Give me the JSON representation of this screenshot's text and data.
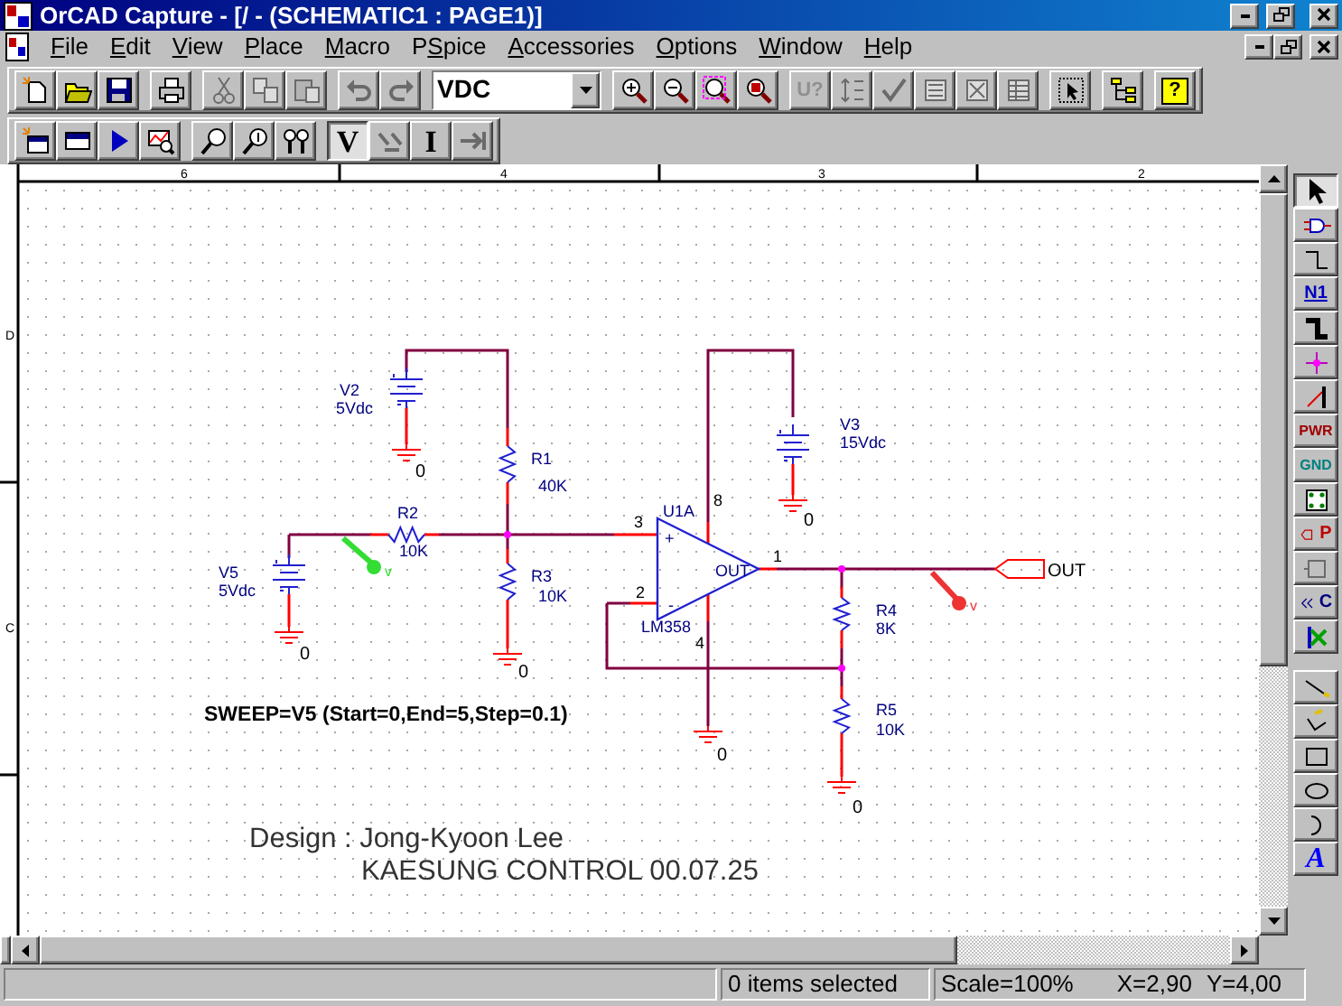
{
  "window": {
    "title": "OrCAD Capture - [/ - (SCHEMATIC1 : PAGE1)]"
  },
  "menu": [
    {
      "key": "F",
      "post": "ile"
    },
    {
      "key": "E",
      "post": "dit"
    },
    {
      "key": "V",
      "post": "iew"
    },
    {
      "key": "P",
      "post": "lace"
    },
    {
      "key": "M",
      "post": "acro"
    },
    {
      "pre": "P",
      "key": "S",
      "post": "pice"
    },
    {
      "key": "A",
      "post": "ccessories"
    },
    {
      "key": "O",
      "post": "ptions"
    },
    {
      "key": "W",
      "post": "indow"
    },
    {
      "key": "H",
      "post": "elp"
    }
  ],
  "toolbar_1": [
    [
      {
        "kind": "new",
        "disabled": false
      },
      {
        "kind": "open",
        "disabled": false
      },
      {
        "kind": "save",
        "disabled": false
      }
    ],
    [
      {
        "kind": "print",
        "disabled": false
      }
    ],
    [
      {
        "kind": "cut",
        "disabled": true
      },
      {
        "kind": "copy",
        "disabled": true
      },
      {
        "kind": "paste",
        "disabled": true
      }
    ],
    [
      {
        "kind": "undo",
        "disabled": true
      },
      {
        "kind": "redo",
        "disabled": true
      }
    ],
    [
      {
        "kind": "combo",
        "value": "VDC"
      }
    ],
    [
      {
        "kind": "zoom-in",
        "disabled": false
      },
      {
        "kind": "zoom-out",
        "disabled": false
      },
      {
        "kind": "zoom-area",
        "disabled": false
      },
      {
        "kind": "zoom-all",
        "disabled": false
      }
    ],
    [
      {
        "kind": "annotate",
        "label": "U?",
        "disabled": true
      },
      {
        "kind": "back-annotate",
        "disabled": true
      },
      {
        "kind": "drc",
        "disabled": true
      },
      {
        "kind": "netlist",
        "disabled": true
      },
      {
        "kind": "cross-ref",
        "disabled": true
      },
      {
        "kind": "bom",
        "disabled": true
      }
    ],
    [
      {
        "kind": "project",
        "disabled": false
      }
    ],
    [
      {
        "kind": "hierarchy",
        "disabled": false
      }
    ],
    [
      {
        "kind": "help",
        "label": "?",
        "disabled": false
      }
    ]
  ],
  "toolbar_2": [
    [
      {
        "kind": "new-profile",
        "disabled": false
      },
      {
        "kind": "edit-profile",
        "disabled": false
      },
      {
        "kind": "run",
        "disabled": false
      },
      {
        "kind": "view-results",
        "disabled": false
      }
    ],
    [
      {
        "kind": "voltage-marker",
        "disabled": false
      },
      {
        "kind": "current-marker",
        "disabled": false
      },
      {
        "kind": "diff-marker",
        "disabled": false
      }
    ],
    [
      {
        "kind": "letter",
        "label": "V",
        "disabled": false,
        "selected": true
      },
      {
        "kind": "vdiff",
        "disabled": true,
        "selected": false
      },
      {
        "kind": "letter",
        "label": "I",
        "disabled": false,
        "selected": false
      },
      {
        "kind": "power-marker",
        "disabled": true,
        "selected": false
      }
    ]
  ],
  "schematic": {
    "border_columns": [
      "6",
      "4",
      "3",
      "2"
    ],
    "border_rows": [
      "D",
      "C"
    ],
    "labels": [
      {
        "kind": "ref",
        "text": "V2"
      },
      {
        "kind": "value",
        "text": "5Vdc"
      },
      {
        "kind": "ground",
        "text": "0"
      },
      {
        "kind": "ref",
        "text": "R1"
      },
      {
        "kind": "value",
        "text": "40K"
      },
      {
        "kind": "ref",
        "text": "R2"
      },
      {
        "kind": "value",
        "text": "10K"
      },
      {
        "kind": "ref",
        "text": "V5"
      },
      {
        "kind": "value",
        "text": "5Vdc"
      },
      {
        "kind": "ground",
        "text": "0"
      },
      {
        "kind": "ref",
        "text": "R3"
      },
      {
        "kind": "value",
        "text": "10K"
      },
      {
        "kind": "ground",
        "text": "0"
      },
      {
        "kind": "pin",
        "text": "3"
      },
      {
        "kind": "pin",
        "text": "2"
      },
      {
        "kind": "ref",
        "text": "U1A"
      },
      {
        "kind": "pin",
        "text": "8"
      },
      {
        "kind": "inner",
        "text": "OUT"
      },
      {
        "kind": "inner",
        "text": "+"
      },
      {
        "kind": "inner",
        "text": "-"
      },
      {
        "kind": "ref",
        "text": "LM358"
      },
      {
        "kind": "pin",
        "text": "4"
      },
      {
        "kind": "ground",
        "text": "0"
      },
      {
        "kind": "ref",
        "text": "V3"
      },
      {
        "kind": "value",
        "text": "15Vdc"
      },
      {
        "kind": "ground",
        "text": "0"
      },
      {
        "kind": "pin",
        "text": "1"
      },
      {
        "kind": "ref",
        "text": "R4"
      },
      {
        "kind": "value",
        "text": "8K"
      },
      {
        "kind": "ref",
        "text": "R5"
      },
      {
        "kind": "value",
        "text": "10K"
      },
      {
        "kind": "ground",
        "text": "0"
      },
      {
        "kind": "net",
        "text": "OUT"
      },
      {
        "kind": "note",
        "text": "SWEEP=V5 (Start=0,End=5,Step=0.1)"
      },
      {
        "kind": "title",
        "text": "Design : Jong-Kyoon Lee"
      },
      {
        "kind": "title",
        "text": "KAESUNG CONTROL 00.07.25"
      }
    ],
    "probes": [
      {
        "text": "v",
        "color": "#33dd33"
      },
      {
        "text": "v",
        "color": "#ee3333"
      }
    ]
  },
  "palette": [
    {
      "kind": "select",
      "disabled": false,
      "selected": true
    },
    {
      "kind": "part",
      "disabled": false,
      "selected": false
    },
    {
      "kind": "wire",
      "disabled": false,
      "selected": false
    },
    {
      "kind": "net-alias",
      "label": "N1",
      "disabled": false,
      "selected": false
    },
    {
      "kind": "bus",
      "disabled": false,
      "selected": false
    },
    {
      "kind": "junction",
      "disabled": false,
      "selected": false
    },
    {
      "kind": "bus-entry",
      "disabled": false,
      "selected": false
    },
    {
      "kind": "power",
      "label": "PWR",
      "disabled": false,
      "selected": false
    },
    {
      "kind": "ground",
      "label": "GND",
      "disabled": false,
      "selected": false
    },
    {
      "kind": "block",
      "disabled": false,
      "selected": false
    },
    {
      "kind": "port",
      "label": "P",
      "disabled": false,
      "selected": false
    },
    {
      "kind": "pin",
      "disabled": true,
      "selected": false
    },
    {
      "kind": "off-page",
      "label": "C",
      "disabled": false,
      "selected": false
    },
    {
      "kind": "no-connect",
      "disabled": false,
      "selected": false
    },
    {
      "kind": "line",
      "disabled": false,
      "selected": false
    },
    {
      "kind": "polyline",
      "disabled": false,
      "selected": false
    },
    {
      "kind": "rect",
      "disabled": false,
      "selected": false
    },
    {
      "kind": "ellipse",
      "disabled": false,
      "selected": false
    },
    {
      "kind": "arc",
      "disabled": false,
      "selected": false
    },
    {
      "kind": "text",
      "label": "A",
      "disabled": false,
      "selected": false
    }
  ],
  "status_bar": {
    "selection": "0 items selected",
    "scale": "Scale=100%",
    "x": "X=2,90",
    "y": "Y=4,00"
  }
}
